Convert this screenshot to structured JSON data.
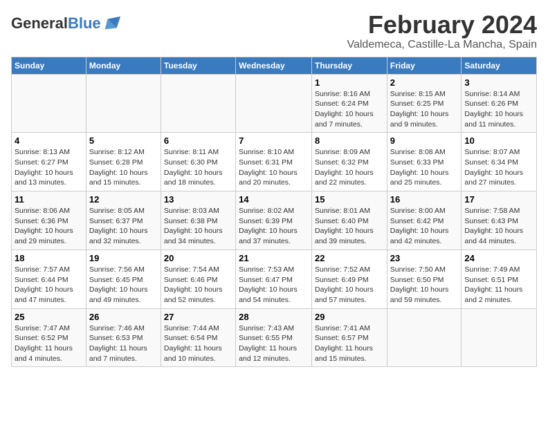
{
  "header": {
    "logo_general": "General",
    "logo_blue": "Blue",
    "title": "February 2024",
    "subtitle": "Valdemeca, Castille-La Mancha, Spain"
  },
  "days_of_week": [
    "Sunday",
    "Monday",
    "Tuesday",
    "Wednesday",
    "Thursday",
    "Friday",
    "Saturday"
  ],
  "weeks": [
    [
      {
        "day": "",
        "info": ""
      },
      {
        "day": "",
        "info": ""
      },
      {
        "day": "",
        "info": ""
      },
      {
        "day": "",
        "info": ""
      },
      {
        "day": "1",
        "info": "Sunrise: 8:16 AM\nSunset: 6:24 PM\nDaylight: 10 hours\nand 7 minutes."
      },
      {
        "day": "2",
        "info": "Sunrise: 8:15 AM\nSunset: 6:25 PM\nDaylight: 10 hours\nand 9 minutes."
      },
      {
        "day": "3",
        "info": "Sunrise: 8:14 AM\nSunset: 6:26 PM\nDaylight: 10 hours\nand 11 minutes."
      }
    ],
    [
      {
        "day": "4",
        "info": "Sunrise: 8:13 AM\nSunset: 6:27 PM\nDaylight: 10 hours\nand 13 minutes."
      },
      {
        "day": "5",
        "info": "Sunrise: 8:12 AM\nSunset: 6:28 PM\nDaylight: 10 hours\nand 15 minutes."
      },
      {
        "day": "6",
        "info": "Sunrise: 8:11 AM\nSunset: 6:30 PM\nDaylight: 10 hours\nand 18 minutes."
      },
      {
        "day": "7",
        "info": "Sunrise: 8:10 AM\nSunset: 6:31 PM\nDaylight: 10 hours\nand 20 minutes."
      },
      {
        "day": "8",
        "info": "Sunrise: 8:09 AM\nSunset: 6:32 PM\nDaylight: 10 hours\nand 22 minutes."
      },
      {
        "day": "9",
        "info": "Sunrise: 8:08 AM\nSunset: 6:33 PM\nDaylight: 10 hours\nand 25 minutes."
      },
      {
        "day": "10",
        "info": "Sunrise: 8:07 AM\nSunset: 6:34 PM\nDaylight: 10 hours\nand 27 minutes."
      }
    ],
    [
      {
        "day": "11",
        "info": "Sunrise: 8:06 AM\nSunset: 6:36 PM\nDaylight: 10 hours\nand 29 minutes."
      },
      {
        "day": "12",
        "info": "Sunrise: 8:05 AM\nSunset: 6:37 PM\nDaylight: 10 hours\nand 32 minutes."
      },
      {
        "day": "13",
        "info": "Sunrise: 8:03 AM\nSunset: 6:38 PM\nDaylight: 10 hours\nand 34 minutes."
      },
      {
        "day": "14",
        "info": "Sunrise: 8:02 AM\nSunset: 6:39 PM\nDaylight: 10 hours\nand 37 minutes."
      },
      {
        "day": "15",
        "info": "Sunrise: 8:01 AM\nSunset: 6:40 PM\nDaylight: 10 hours\nand 39 minutes."
      },
      {
        "day": "16",
        "info": "Sunrise: 8:00 AM\nSunset: 6:42 PM\nDaylight: 10 hours\nand 42 minutes."
      },
      {
        "day": "17",
        "info": "Sunrise: 7:58 AM\nSunset: 6:43 PM\nDaylight: 10 hours\nand 44 minutes."
      }
    ],
    [
      {
        "day": "18",
        "info": "Sunrise: 7:57 AM\nSunset: 6:44 PM\nDaylight: 10 hours\nand 47 minutes."
      },
      {
        "day": "19",
        "info": "Sunrise: 7:56 AM\nSunset: 6:45 PM\nDaylight: 10 hours\nand 49 minutes."
      },
      {
        "day": "20",
        "info": "Sunrise: 7:54 AM\nSunset: 6:46 PM\nDaylight: 10 hours\nand 52 minutes."
      },
      {
        "day": "21",
        "info": "Sunrise: 7:53 AM\nSunset: 6:47 PM\nDaylight: 10 hours\nand 54 minutes."
      },
      {
        "day": "22",
        "info": "Sunrise: 7:52 AM\nSunset: 6:49 PM\nDaylight: 10 hours\nand 57 minutes."
      },
      {
        "day": "23",
        "info": "Sunrise: 7:50 AM\nSunset: 6:50 PM\nDaylight: 10 hours\nand 59 minutes."
      },
      {
        "day": "24",
        "info": "Sunrise: 7:49 AM\nSunset: 6:51 PM\nDaylight: 11 hours\nand 2 minutes."
      }
    ],
    [
      {
        "day": "25",
        "info": "Sunrise: 7:47 AM\nSunset: 6:52 PM\nDaylight: 11 hours\nand 4 minutes."
      },
      {
        "day": "26",
        "info": "Sunrise: 7:46 AM\nSunset: 6:53 PM\nDaylight: 11 hours\nand 7 minutes."
      },
      {
        "day": "27",
        "info": "Sunrise: 7:44 AM\nSunset: 6:54 PM\nDaylight: 11 hours\nand 10 minutes."
      },
      {
        "day": "28",
        "info": "Sunrise: 7:43 AM\nSunset: 6:55 PM\nDaylight: 11 hours\nand 12 minutes."
      },
      {
        "day": "29",
        "info": "Sunrise: 7:41 AM\nSunset: 6:57 PM\nDaylight: 11 hours\nand 15 minutes."
      },
      {
        "day": "",
        "info": ""
      },
      {
        "day": "",
        "info": ""
      }
    ]
  ]
}
